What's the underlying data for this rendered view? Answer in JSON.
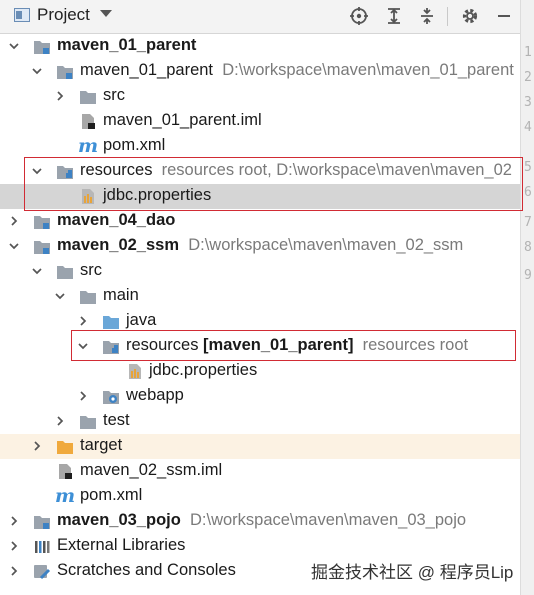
{
  "header": {
    "title": "Project",
    "tool_icons": [
      "locate-icon",
      "expand-all-icon",
      "collapse-all-icon",
      "gear-icon",
      "minimize-icon"
    ]
  },
  "gutter": {
    "line_numbers": [
      "1",
      "2",
      "3",
      "4",
      "5",
      "6",
      "7",
      "8",
      "9"
    ]
  },
  "tree": {
    "r0": {
      "name": "maven_01_parent"
    },
    "r1": {
      "name": "maven_01_parent",
      "path": "D:\\workspace\\maven\\maven_01_parent"
    },
    "r2": {
      "name": "src"
    },
    "r3": {
      "name": "maven_01_parent.iml"
    },
    "r4": {
      "name": "pom.xml"
    },
    "r5": {
      "name": "resources",
      "path": "resources root,  D:\\workspace\\maven\\maven_02"
    },
    "r6": {
      "name": "jdbc.properties"
    },
    "r7": {
      "name": "maven_04_dao"
    },
    "r8": {
      "name": "maven_02_ssm",
      "path": "D:\\workspace\\maven\\maven_02_ssm"
    },
    "r9": {
      "name": "src"
    },
    "r10": {
      "name": "main"
    },
    "r11": {
      "name": "java"
    },
    "r12": {
      "name": "resources",
      "module": "[maven_01_parent]",
      "path": "resources root"
    },
    "r13": {
      "name": "jdbc.properties"
    },
    "r14": {
      "name": "webapp"
    },
    "r15": {
      "name": "test"
    },
    "r16": {
      "name": "target"
    },
    "r17": {
      "name": "maven_02_ssm.iml"
    },
    "r18": {
      "name": "pom.xml"
    },
    "r19": {
      "name": "maven_03_pojo",
      "path": "D:\\workspace\\maven\\maven_03_pojo"
    },
    "r20": {
      "name": "External Libraries"
    },
    "r21": {
      "name": "Scratches and Consoles"
    }
  },
  "watermark": "掘金技术社区 @ 程序员Lip",
  "colors": {
    "selected_row": "#d5d5d5",
    "highlight_box": "#d12b34",
    "target_row": "#fcf2e3",
    "folder_blue": "#6aa7d8",
    "folder_orange": "#f0a93c"
  }
}
